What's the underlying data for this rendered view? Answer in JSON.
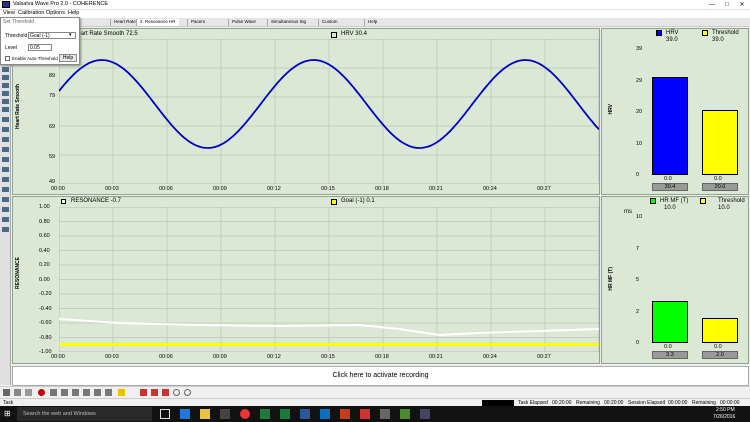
{
  "window": {
    "title": "Valsalva Wave Pro 2.0 - COHERENCE",
    "min": "—",
    "max": "□",
    "close": "✕"
  },
  "menu": [
    "View",
    "Calibration",
    "Options",
    "Help"
  ],
  "tabs": [
    {
      "label": "Heart Rate"
    },
    {
      "label": "2. Resonance HR",
      "active": true
    },
    {
      "label": "Pacers"
    },
    {
      "label": "Pulse Wave"
    },
    {
      "label": "Simultaneous Sig"
    },
    {
      "label": "Custom"
    },
    {
      "label": "Help"
    }
  ],
  "dialog": {
    "title": "Set Threshold",
    "threshold_label": "Threshold",
    "threshold_value": "Goal (-1)",
    "level_label": "Level",
    "level_value": "0.05",
    "auto_label": "Enable Auto-Threshold",
    "help": "Help"
  },
  "hr_panel": {
    "title": "Heart Rate Smooth 72.5",
    "hrv_legend": "HRV 30.4",
    "ylabel": "Heart Rate Smooth",
    "yticks": [
      "89",
      "79",
      "69",
      "59",
      "49"
    ],
    "xticks": [
      "00:00",
      "00:03",
      "00:06",
      "00:09",
      "00:12",
      "00:15",
      "00:18",
      "00:21",
      "00:24",
      "00:27"
    ],
    "line_color": "#0000cc"
  },
  "res_panel": {
    "title": "RESONANCE -0.7",
    "goal_legend": "Goal (-1)  0.1",
    "ylabel": "RESONANCE",
    "yticks": [
      "1.00",
      "0.80",
      "0.60",
      "0.40",
      "0.20",
      "0.00",
      "-0.20",
      "-0.40",
      "-0.60",
      "-0.80",
      "-1.00"
    ],
    "xticks": [
      "00:00",
      "00:03",
      "00:06",
      "00:09",
      "00:12",
      "00:15",
      "00:18",
      "00:21",
      "00:24",
      "00:27"
    ],
    "line_color": "#ffffff",
    "goal_color": "#ffff00"
  },
  "hrv_bars": {
    "legend": [
      {
        "label": "HRV",
        "value": "39.0",
        "color": "#0000ff"
      },
      {
        "label": "Threshold",
        "value": "39.0",
        "color": "#ffff00"
      }
    ],
    "ylabel": "HRV",
    "yticks": [
      "39",
      "29",
      "20",
      "10",
      "0"
    ],
    "bars": [
      {
        "name": "hrv",
        "value": 30.4,
        "top_label": "0.0",
        "bottom_label": "30.4",
        "color": "#0000ff"
      },
      {
        "name": "threshold",
        "value": 20.0,
        "top_label": "0.0",
        "bottom_label": "20.0",
        "color": "#ffff00"
      }
    ],
    "ymax": 39
  },
  "mf_bars": {
    "legend": [
      {
        "label": "HR MF (T)",
        "value": "10.0",
        "color": "#00ff00"
      },
      {
        "label": "Threshold",
        "value": "10.0",
        "color": "#ffff00"
      }
    ],
    "unit": "ms",
    "ylabel": "HR MF (T)",
    "yticks": [
      "10",
      "7",
      "5",
      "2",
      "0"
    ],
    "bars": [
      {
        "name": "hr-mf",
        "value": 3.3,
        "top_label": "0.0",
        "bottom_label": "3.3",
        "color": "#00ff00"
      },
      {
        "name": "threshold",
        "value": 2.0,
        "top_label": "0.0",
        "bottom_label": "2.0",
        "color": "#ffff00"
      }
    ],
    "ymax": 10
  },
  "record": {
    "label": "Click here to activate recording"
  },
  "status": {
    "task": "Task",
    "task_elapsed_label": "Task Elapsed",
    "task_elapsed": "00:20:00",
    "remaining_label": "Remaining",
    "remaining": "00:20:00",
    "session_elapsed_label": "Session Elapsed",
    "session_elapsed": "00:00:00",
    "remaining2_label": "Remaining",
    "remaining2": "00:00:00"
  },
  "taskbar": {
    "search": "Search the web and Windows",
    "time": "2:50 PM",
    "date": "7/26/2016"
  }
}
